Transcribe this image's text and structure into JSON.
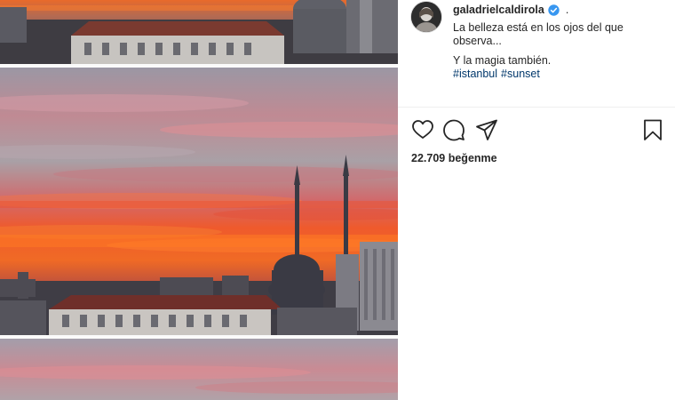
{
  "post": {
    "username": "galadrielcaldirola",
    "separator": ".",
    "caption_lines": [
      "La belleza está en los ojos del que",
      "observa...",
      "Y la magia también."
    ],
    "hashtags": [
      "#istanbul",
      "#sunset"
    ],
    "likes_count": "22.709",
    "likes_label": "beğenme"
  },
  "icons": {
    "verified": "verified-badge-icon",
    "like": "heart-icon",
    "comment": "comment-bubble-icon",
    "share": "paper-plane-icon",
    "save": "bookmark-icon"
  },
  "colors": {
    "verified": "#3897f0",
    "hashtag": "#00376b",
    "text": "#262626"
  }
}
